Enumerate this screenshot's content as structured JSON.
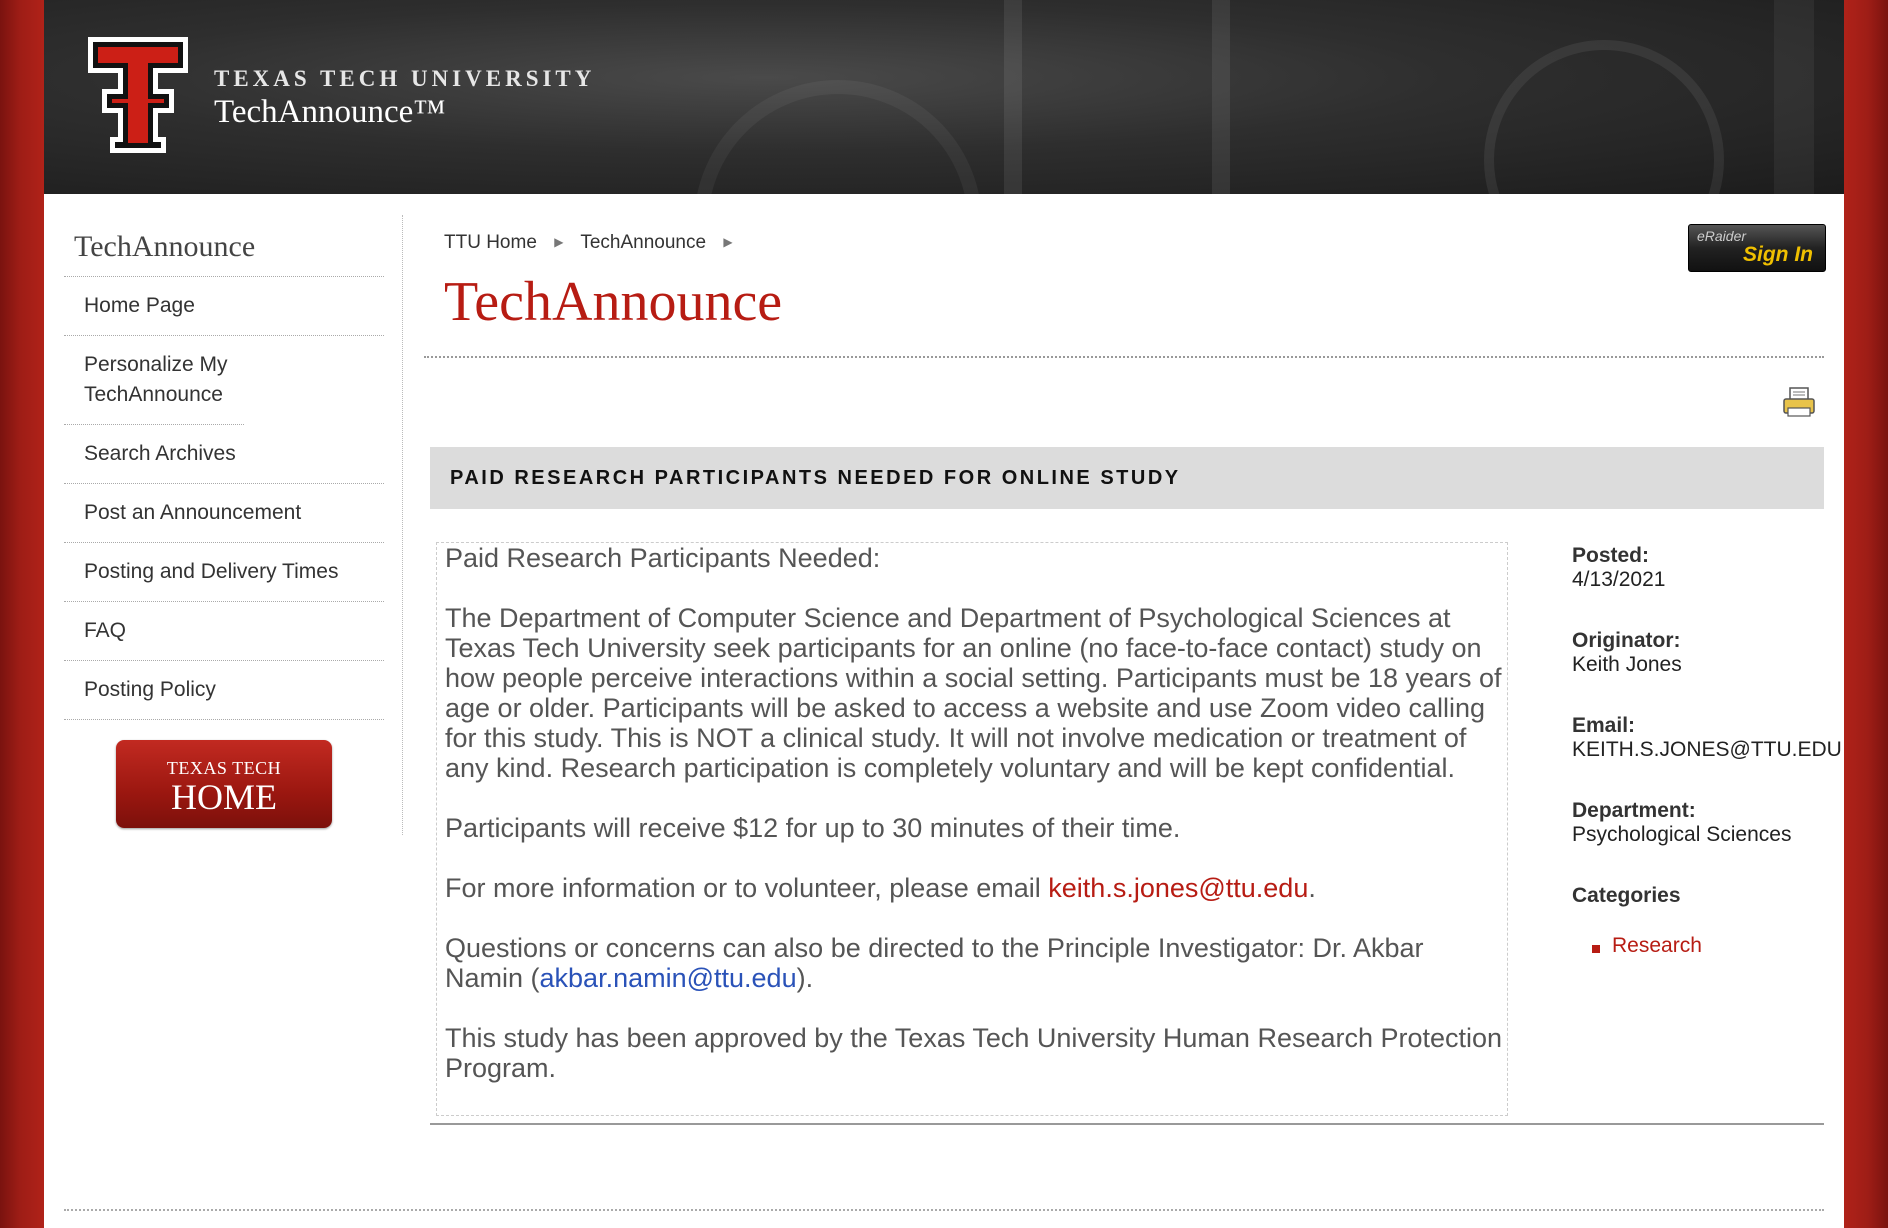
{
  "header": {
    "university": "TEXAS TECH UNIVERSITY",
    "site_name": "TechAnnounce™"
  },
  "sidebar": {
    "title": "TechAnnounce",
    "items": [
      {
        "label": "Home Page"
      },
      {
        "label": "Personalize My TechAnnounce"
      },
      {
        "label": "Search Archives"
      },
      {
        "label": "Post an Announcement"
      },
      {
        "label": "Posting and Delivery Times"
      },
      {
        "label": "FAQ"
      },
      {
        "label": "Posting Policy"
      }
    ],
    "home_button": {
      "line1": "TEXAS TECH",
      "line2": "HOME"
    }
  },
  "breadcrumb": [
    "TTU Home",
    "TechAnnounce"
  ],
  "signin": {
    "top": "eRaider",
    "label": "Sign In"
  },
  "page_title": "TechAnnounce",
  "announcement": {
    "title": "PAID RESEARCH PARTICIPANTS NEEDED FOR ONLINE STUDY",
    "p1": "Paid Research Participants Needed:",
    "p2": "The Department of Computer Science and Department of Psychological Sciences at Texas Tech University seek participants for an online (no face-to-face contact) study on how people perceive interactions within a social setting. Participants must be 18 years of age or older. Participants will be asked to access a website and use Zoom video calling for this study. This is NOT a clinical study. It will not involve medication or treatment of any kind. Research participation is completely voluntary and will be kept confidential.",
    "p3": "Participants will receive $12 for up to 30 minutes of their time.",
    "p4_pre": "For more information or to volunteer, please email ",
    "p4_link": "keith.s.jones@ttu.edu",
    "p4_post": ".",
    "p5_pre": "Questions or concerns can also be directed to the Principle Investigator: Dr. Akbar Namin (",
    "p5_link": "akbar.namin@ttu.edu",
    "p5_post": ").",
    "p6": "This study has been approved by the Texas Tech University Human Research Protection Program."
  },
  "meta": {
    "posted_label": "Posted:",
    "posted": "4/13/2021",
    "originator_label": "Originator:",
    "originator": "Keith Jones",
    "email_label": "Email:",
    "email": "KEITH.S.JONES@TTU.EDU",
    "department_label": "Department:",
    "department": "Psychological Sciences",
    "categories_label": "Categories",
    "categories": [
      "Research"
    ]
  },
  "icons": {
    "print": "print-icon",
    "breadcrumb_sep": "triangle-right-icon"
  },
  "colors": {
    "brand_red": "#b71c13",
    "link_blue": "#2a52b8",
    "bar_gray": "#dcdcdc"
  }
}
